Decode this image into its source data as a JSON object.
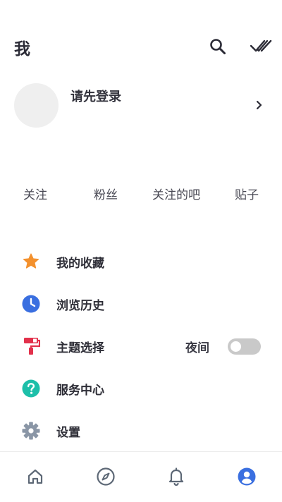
{
  "header": {
    "title": "我",
    "search_icon": "search-icon",
    "mark_all_icon": "double-check-icon"
  },
  "profile": {
    "login_prompt": "请先登录",
    "avatar_icon": "avatar-placeholder",
    "chevron_icon": "chevron-right-icon"
  },
  "stats": [
    {
      "label": "关注"
    },
    {
      "label": "粉丝"
    },
    {
      "label": "关注的吧"
    },
    {
      "label": "贴子"
    }
  ],
  "menu": [
    {
      "label": "我的收藏",
      "icon": "star-icon",
      "color": "#F3912E"
    },
    {
      "label": "浏览历史",
      "icon": "clock-icon",
      "color": "#3A6FE0"
    },
    {
      "label": "主题选择",
      "icon": "paint-roller-icon",
      "color": "#E2314B",
      "night_label": "夜间",
      "night_mode_on": false
    },
    {
      "label": "服务中心",
      "icon": "help-icon",
      "color": "#1DBFA9"
    },
    {
      "label": "设置",
      "icon": "gear-icon",
      "color": "#8A96A6"
    }
  ],
  "bottom_nav": [
    {
      "name": "home",
      "icon": "home-icon",
      "active": false
    },
    {
      "name": "explore",
      "icon": "compass-icon",
      "active": false
    },
    {
      "name": "notifications",
      "icon": "bell-icon",
      "active": false
    },
    {
      "name": "me",
      "icon": "user-circle-icon",
      "active": true
    }
  ],
  "colors": {
    "active_nav": "#3A6FE0",
    "inactive_nav": "#5D6876",
    "text_primary": "#2B2B36",
    "toggle_off": "#C9C9C9"
  }
}
